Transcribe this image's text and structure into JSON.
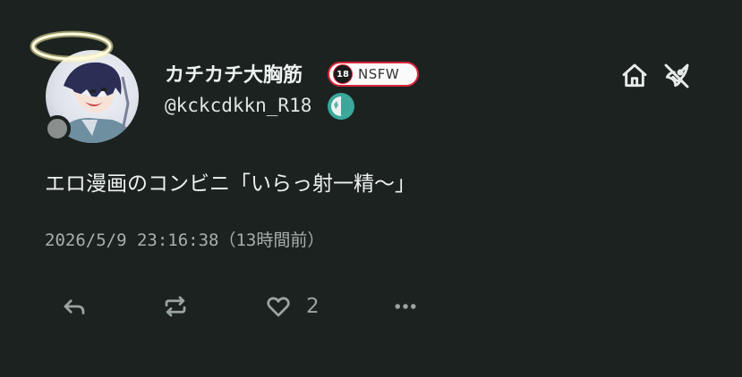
{
  "user": {
    "display_name": "カチカチ大胸筋",
    "username": "@kckcdkkn_R18",
    "badge_icon_text": "18",
    "badge_text": "NSFW"
  },
  "note": {
    "text": "エロ漫画のコンビニ「いらっ射一精～」",
    "timestamp": "2026/5/9 23:16:38（13時間前）"
  },
  "actions": {
    "reaction_count": "2"
  },
  "icons": {
    "header": [
      "home-icon",
      "rocket-off-icon"
    ],
    "footer": [
      "reply-icon",
      "renote-icon",
      "heart-icon",
      "more-icon"
    ]
  },
  "colors": {
    "background": "#1b2220",
    "badge_border": "#d7243a",
    "instance_icon": "#3aa79a",
    "muted_text": "#a7b0ad"
  }
}
